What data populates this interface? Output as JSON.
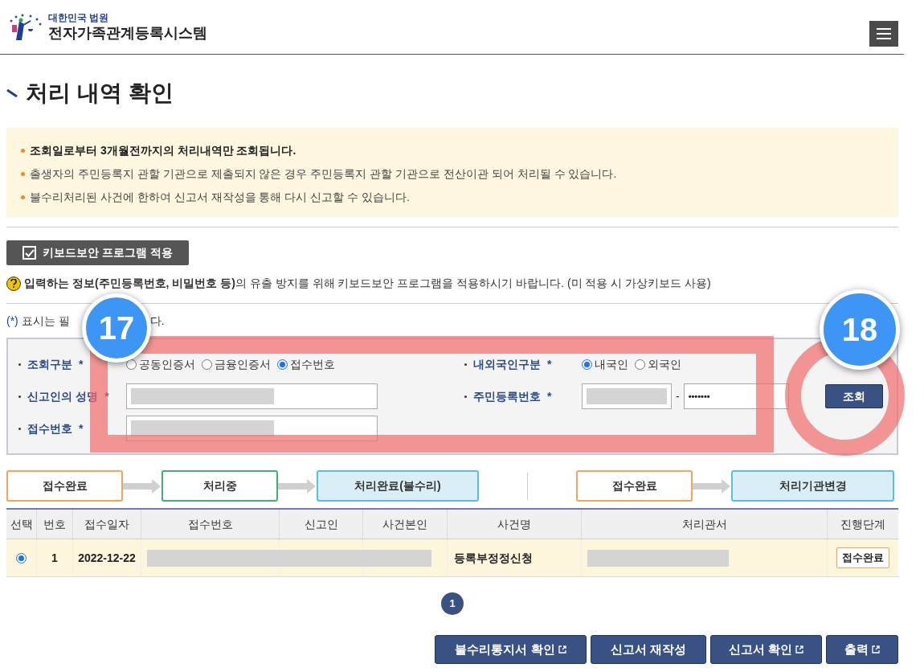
{
  "header": {
    "org": "대한민국 법원",
    "system": "전자가족관계등록시스템"
  },
  "title": "처리 내역 확인",
  "notices": [
    {
      "text": "조회일로부터 3개월전까지의 처리내역만 조회됩니다.",
      "bold": true
    },
    {
      "text": "출생자의 주민등록지 관할 기관으로 제출되지 않은 경우 주민등록지 관할 기관으로 전산이관 되어 처리될 수 있습니다.",
      "bold": false
    },
    {
      "text": "불수리처리된 사건에 한하여 신고서 재작성을 통해 다시 신고할 수 있습니다.",
      "bold": false
    }
  ],
  "security_button": {
    "label": "키보드보안 프로그램 적용",
    "checked": true
  },
  "security_note": "**입력하는 정보(주민등록번호, 비밀번호 등)**의 유출 방지를 위해 키보드보안 프로그램을 적용하시기 바랍니다. (미 적용 시 가상키보드 사용)",
  "required_note": {
    "mark": "(*)",
    "parts": [
      "표시는 필",
      "다."
    ]
  },
  "form": {
    "search_type": {
      "label": "조회구분",
      "mark": "*",
      "options": [
        {
          "label": "공동인증서",
          "selected": false
        },
        {
          "label": "금융인증서",
          "selected": false
        },
        {
          "label": "접수번호",
          "selected": true
        }
      ]
    },
    "nationality": {
      "label": "내외국인구분",
      "mark": "*",
      "options": [
        {
          "label": "내국인",
          "selected": true
        },
        {
          "label": "외국인",
          "selected": false
        }
      ]
    },
    "reporter_name": {
      "label": "신고인의 성명",
      "mark": "*",
      "redacted": true
    },
    "resident_number": {
      "label": "주민등록번호",
      "mark": "*",
      "first_redacted": true,
      "separator": "-",
      "second_value": "•••••••"
    },
    "receipt_number": {
      "label": "접수번호",
      "mark": "*",
      "redacted": true
    },
    "search_button": "조회"
  },
  "legend": [
    [
      {
        "label": "접수완료",
        "color": "#f5a45d"
      },
      {
        "label": "처리중",
        "color": "#3cb371"
      },
      {
        "label": "처리완료(불수리)",
        "color": "#5bc0de"
      }
    ],
    [
      {
        "label": "접수완료",
        "color": "#f5a45d"
      },
      {
        "label": "처리기관변경",
        "color": "#5bc0de"
      }
    ]
  ],
  "table": {
    "columns": [
      "선택",
      "번호",
      "접수일자",
      "접수번호",
      "신고인",
      "사건본인",
      "사건명",
      "처리관서",
      "진행단계"
    ],
    "rows": [
      {
        "selected": true,
        "number": "1",
        "date": "2022-12-22",
        "receipt_redacted": true,
        "case_name": "등록부정정신청",
        "office_redacted": true,
        "stage": "접수완료"
      }
    ]
  },
  "pagination": [
    {
      "label": "1",
      "selected": true
    }
  ],
  "buttons": [
    {
      "label": "불수리통지서 확인",
      "external": true
    },
    {
      "label": "신고서 재작성",
      "external": false
    },
    {
      "label": "신고서 확인",
      "external": true
    },
    {
      "label": "출력",
      "external": true
    }
  ],
  "annotations": [
    {
      "kind": "box"
    },
    {
      "kind": "ring"
    },
    {
      "kind": "badge",
      "label": "17"
    },
    {
      "kind": "badge",
      "label": "18"
    }
  ]
}
